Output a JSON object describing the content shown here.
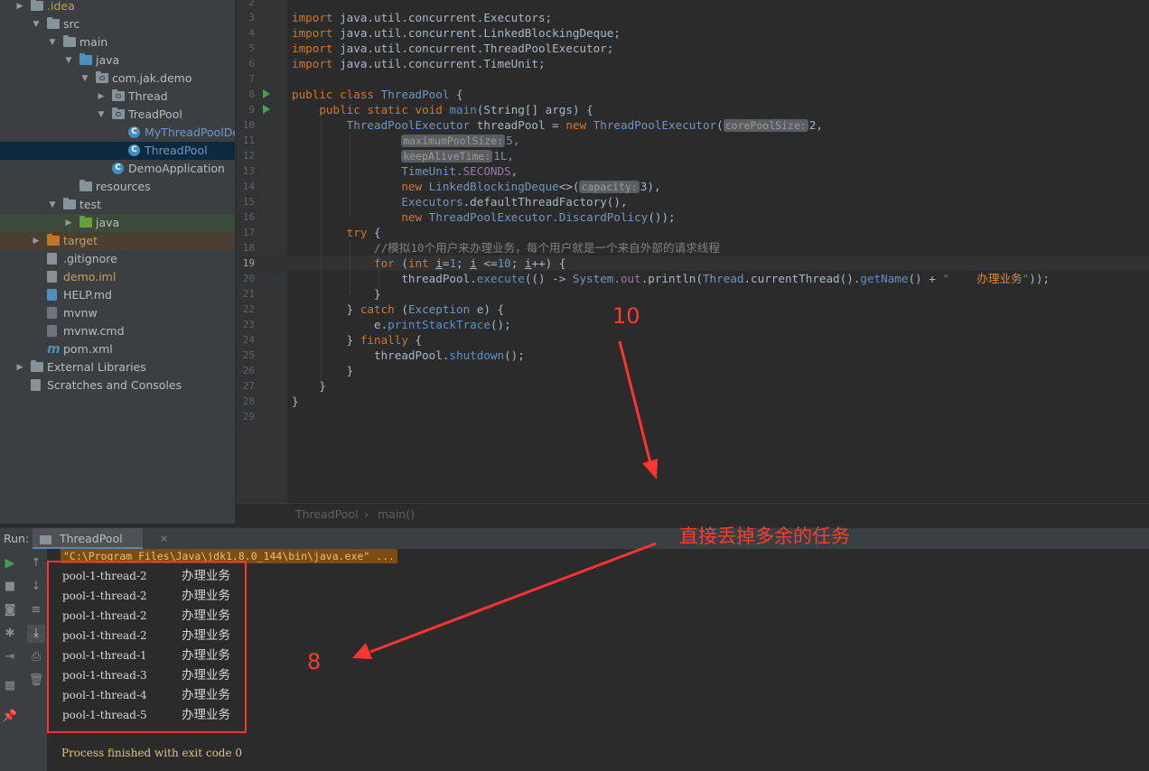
{
  "project_tree": [
    {
      "label": ".idea",
      "icon": "folder-icon",
      "color": "yellow",
      "expand": "collapsed"
    },
    {
      "label": "src",
      "icon": "folder-icon",
      "color": "normal",
      "expand": "expanded"
    },
    {
      "label": "main",
      "icon": "folder-icon",
      "color": "normal",
      "expand": "expanded"
    },
    {
      "label": "java",
      "icon": "source-folder-icon",
      "color": "normal",
      "expand": "expanded"
    },
    {
      "label": "com.jak.demo",
      "icon": "package-icon",
      "color": "normal",
      "expand": "expanded"
    },
    {
      "label": "Thread",
      "icon": "package-icon",
      "color": "normal",
      "expand": "collapsed"
    },
    {
      "label": "TreadPool",
      "icon": "package-icon",
      "color": "normal",
      "expand": "expanded"
    },
    {
      "label": "MyThreadPoolDemo",
      "icon": "java-class-icon",
      "color": "blue",
      "expand": "none"
    },
    {
      "label": "ThreadPool",
      "icon": "java-class-icon",
      "color": "blue",
      "expand": "none"
    },
    {
      "label": "DemoApplication",
      "icon": "spring-class-icon",
      "color": "normal",
      "expand": "none"
    },
    {
      "label": "resources",
      "icon": "resources-folder-icon",
      "color": "normal",
      "expand": "none"
    },
    {
      "label": "test",
      "icon": "folder-icon",
      "color": "normal",
      "expand": "expanded"
    },
    {
      "label": "java",
      "icon": "test-folder-icon",
      "color": "normal",
      "expand": "collapsed"
    },
    {
      "label": "target",
      "icon": "excluded-folder-icon",
      "color": "yellow",
      "expand": "collapsed"
    },
    {
      "label": ".gitignore",
      "icon": "gitignore-file-icon",
      "color": "normal",
      "expand": "none"
    },
    {
      "label": "demo.iml",
      "icon": "iml-file-icon",
      "color": "yellow",
      "expand": "none"
    },
    {
      "label": "HELP.md",
      "icon": "markdown-file-icon",
      "color": "normal",
      "expand": "none"
    },
    {
      "label": "mvnw",
      "icon": "script-file-icon",
      "color": "normal",
      "expand": "none"
    },
    {
      "label": "mvnw.cmd",
      "icon": "script-file-icon",
      "color": "normal",
      "expand": "none"
    },
    {
      "label": "pom.xml",
      "icon": "maven-icon",
      "color": "normal",
      "expand": "none"
    },
    {
      "label": "External Libraries",
      "icon": "libraries-icon",
      "color": "normal",
      "expand": "collapsed"
    },
    {
      "label": "Scratches and Consoles",
      "icon": "scratches-icon",
      "color": "normal",
      "expand": "none"
    }
  ],
  "editor": {
    "line_numbers": [
      "2",
      "3",
      "4",
      "5",
      "6",
      "7",
      "8",
      "9",
      "10",
      "11",
      "12",
      "13",
      "14",
      "15",
      "16",
      "17",
      "18",
      "19",
      "20",
      "21",
      "22",
      "23",
      "24",
      "25",
      "26",
      "27",
      "28",
      "29"
    ],
    "imports": [
      "java.util.concurrent.Executors;",
      "java.util.concurrent.LinkedBlockingDeque;",
      "java.util.concurrent.ThreadPoolExecutor;",
      "java.util.concurrent.TimeUnit;"
    ],
    "kw_import": "import",
    "class_decl": {
      "kw1": "public",
      "kw2": "class",
      "name": "ThreadPool",
      "brace": " {"
    },
    "main_decl": {
      "kw1": "public",
      "kw2": "static",
      "kw3": "void",
      "name": "main",
      "params": "(String[] args) {"
    },
    "l10": {
      "type": "ThreadPoolExecutor",
      "var": " threadPool = ",
      "kw_new": "new",
      "ctor": "ThreadPoolExecutor",
      "hint": "corePoolSize:",
      "val": "2,"
    },
    "l11": {
      "hint": "maximumPoolSize:",
      "val": "5,"
    },
    "l12": {
      "hint": "keepAliveTime:",
      "val": "1L,"
    },
    "l13": {
      "type": "TimeUnit.",
      "const": "SECONDS",
      "tail": ","
    },
    "l14": {
      "kw_new": "new",
      "type": "LinkedBlockingDeque",
      "mid": "<>(",
      "hint": "capacity:",
      "val": "3),"
    },
    "l15": {
      "type": "Executors",
      "tail": ".defaultThreadFactory(),"
    },
    "l16": {
      "kw_new": "new",
      "type": "ThreadPoolExecutor.",
      "method": "DiscardPolicy",
      "tail": "());"
    },
    "l17": {
      "kw": "try",
      "tail": " {"
    },
    "l18": "//模拟10个用户来办理业务，每个用户就是一个来自外部的请求线程",
    "l19": {
      "kw_for": "for",
      "open": " (",
      "kw_int": "int",
      "v1": "i",
      "init": "=",
      "n1": "1",
      "sep1": "; ",
      "v2": "i",
      "cmp": " <=",
      "n2": "10",
      "sep2": "; ",
      "v3": "i",
      "inc": "++) {"
    },
    "l20": {
      "pre": "threadPool.",
      "m1": "execute",
      "mid1": "(() -> ",
      "sys": "System.",
      "out": "out",
      "mid2": ".println(",
      "thr": "Thread",
      "mid3": ".currentThread().",
      "m2": "getName",
      "mid4": "() + ",
      "str_open": "\"    ",
      "str_cn": "办理业务",
      "str_close": "\"",
      "tail": "));"
    },
    "l21": "}",
    "l22": {
      "pre": "} ",
      "kw": "catch",
      "mid": " (",
      "type": "Exception",
      "tail": " e) {"
    },
    "l23": {
      "pre": "e.",
      "method": "printStackTrace",
      "tail": "();"
    },
    "l24": {
      "pre": "} ",
      "kw": "finally",
      "tail": " {"
    },
    "l25": {
      "pre": "threadPool.",
      "method": "shutdown",
      "tail": "();"
    },
    "l26": "}",
    "l27": "}",
    "l28": "}"
  },
  "breadcrumb": {
    "class": "ThreadPool",
    "sep": "›",
    "method": "main()"
  },
  "run_panel": {
    "label": "Run:",
    "tab": "ThreadPool",
    "close": "×",
    "command": "\"C:\\Program Files\\Java\\jdk1.8.0_144\\bin\\java.exe\" ...",
    "output": [
      {
        "thread": "pool-1-thread-2",
        "task": "办理业务"
      },
      {
        "thread": "pool-1-thread-2",
        "task": "办理业务"
      },
      {
        "thread": "pool-1-thread-2",
        "task": "办理业务"
      },
      {
        "thread": "pool-1-thread-2",
        "task": "办理业务"
      },
      {
        "thread": "pool-1-thread-1",
        "task": "办理业务"
      },
      {
        "thread": "pool-1-thread-3",
        "task": "办理业务"
      },
      {
        "thread": "pool-1-thread-4",
        "task": "办理业务"
      },
      {
        "thread": "pool-1-thread-5",
        "task": "办理业务"
      }
    ],
    "finished": "Process finished with exit code 0"
  },
  "annotations": {
    "ten": "10",
    "eight": "8",
    "note": "直接丢掉多余的任务",
    "color": "#ff3b2f"
  },
  "colors": {
    "selected_row": "#0d293e",
    "keyword": "#cc7832",
    "string": "#6a8759",
    "accent": "#4a88c7"
  }
}
